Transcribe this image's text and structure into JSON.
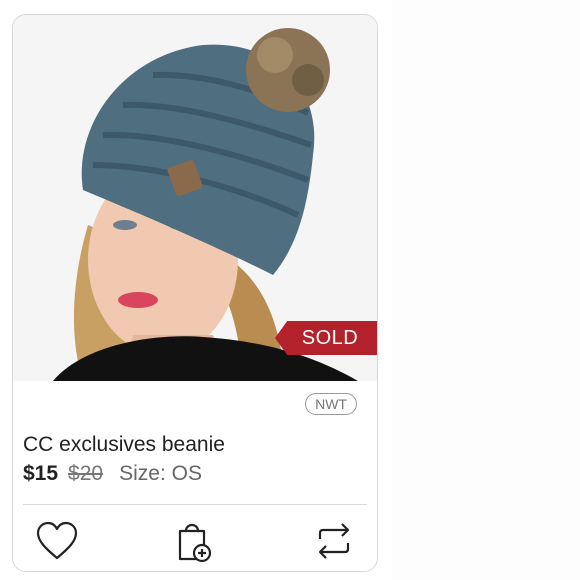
{
  "listing": {
    "badge_sold": "SOLD",
    "condition": "NWT",
    "title": "CC exclusives beanie",
    "price": "$15",
    "original_price": "$20",
    "size": "Size: OS"
  },
  "colors": {
    "sold_banner": "#b3212a",
    "beanie": "#4f6e80",
    "pom": "#8a7455"
  },
  "icons": {
    "like": "heart-icon",
    "bundle": "shopping-bag-add-icon",
    "share": "repost-icon"
  }
}
